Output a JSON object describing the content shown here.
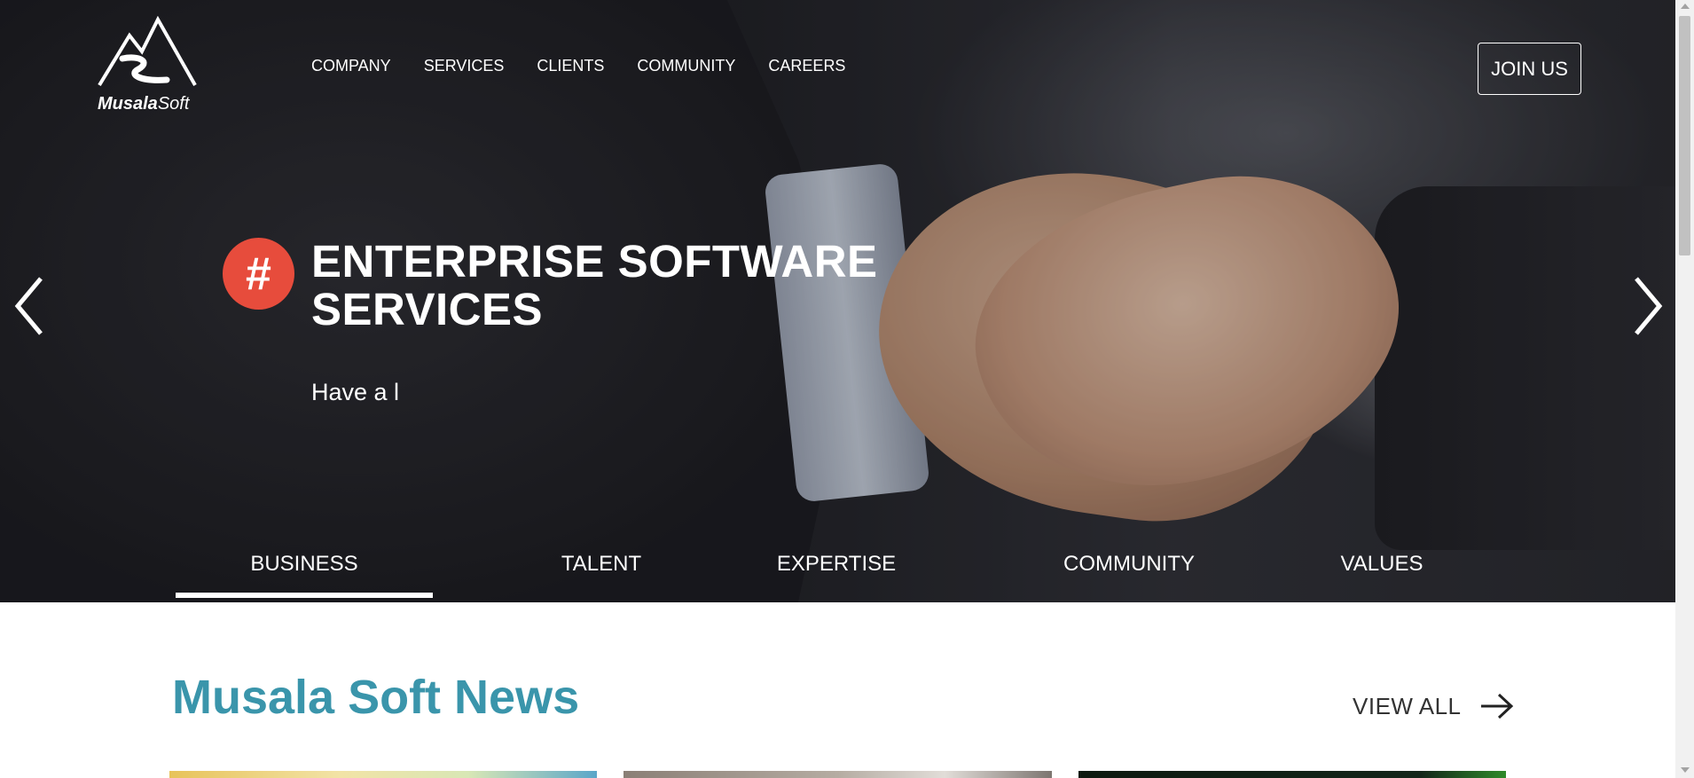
{
  "header": {
    "logo_text_bold": "Musala",
    "logo_text_light": "Soft",
    "nav": [
      "COMPANY",
      "SERVICES",
      "CLIENTS",
      "COMMUNITY",
      "CAREERS"
    ],
    "join_label": "JOIN US"
  },
  "hero": {
    "badge": "#",
    "title_line1": "ENTERPRISE SOFTWARE",
    "title_line2": "SERVICES",
    "subtitle": "Have a l",
    "tabs": [
      "BUSINESS",
      "TALENT",
      "EXPERTISE",
      "COMMUNITY",
      "VALUES"
    ],
    "active_tab": "BUSINESS"
  },
  "news": {
    "title": "Musala Soft News",
    "view_all": "VIEW ALL"
  },
  "colors": {
    "accent_teal": "#3a95ab",
    "badge_red": "#e74c3c"
  }
}
